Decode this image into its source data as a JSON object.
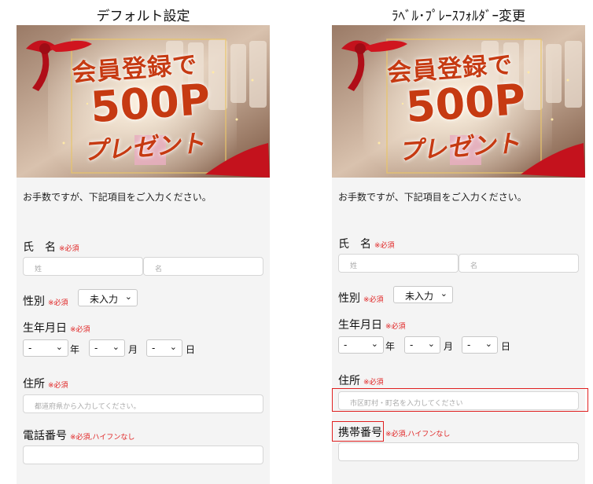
{
  "left": {
    "title": "デフォルト設定",
    "banner": {
      "line1": "会員登録で",
      "line2": "500P",
      "line3": "プレゼント"
    },
    "intro": "お手数ですが、下記項目をご入力ください。",
    "name_label": "氏　名",
    "required": "※必須",
    "last_placeholder": "姓",
    "first_placeholder": "名",
    "gender_label": "性別",
    "gender_value": "未入力",
    "birth_label": "生年月日",
    "birth_select": "-",
    "year_unit": "年",
    "month_unit": "月",
    "day_unit": "日",
    "address_label": "住所",
    "address_placeholder": "都道府県から入力してください。",
    "phone_label": "電話番号",
    "phone_note": "※必須,ハイフンなし",
    "phone_value": ""
  },
  "right": {
    "title": "ﾗﾍﾞﾙ･ﾌﾟﾚｰｽﾌｫﾙﾀﾞｰ変更",
    "banner": {
      "line1": "会員登録で",
      "line2": "500P",
      "line3": "プレゼント"
    },
    "intro": "お手数ですが、下記項目をご入力ください。",
    "name_label": "氏　名",
    "required": "※必須",
    "last_placeholder": "姓",
    "first_placeholder": "名",
    "gender_label": "性別",
    "gender_value": "未入力",
    "birth_label": "生年月日",
    "birth_select": "-",
    "year_unit": "年",
    "month_unit": "月",
    "day_unit": "日",
    "address_label": "住所",
    "address_placeholder": "市区町村・町名を入力してください",
    "phone_label": "携帯番号",
    "phone_note": "※必須,ハイフンなし",
    "phone_value": ""
  },
  "colors": {
    "required": "#e02020",
    "highlight": "#e02020",
    "banner_text": "#c63a12"
  }
}
